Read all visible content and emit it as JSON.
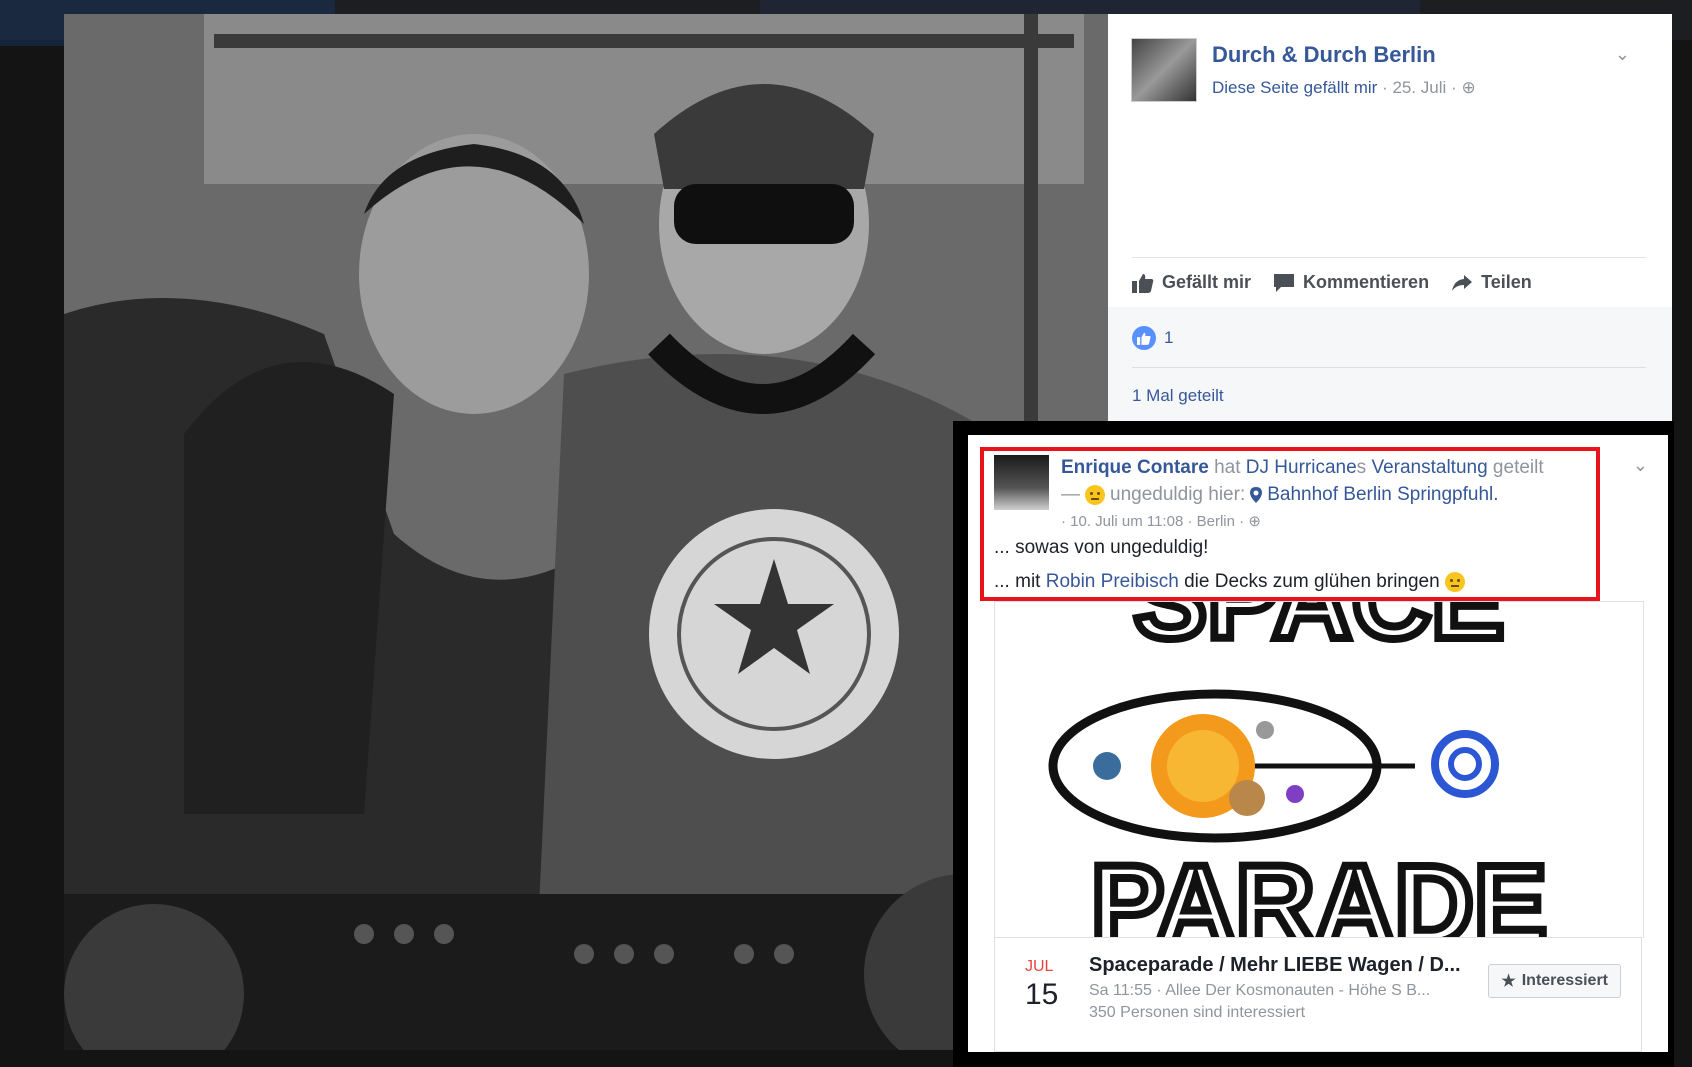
{
  "post": {
    "page_name": "Durch & Durch Berlin",
    "liked_label": "Diese Seite gefällt mir",
    "date": " · 25. Juli · ",
    "actions": {
      "like": "Gefällt mir",
      "comment": "Kommentieren",
      "share": "Teilen"
    },
    "like_count": "1",
    "share_count": "1 Mal geteilt"
  },
  "shared_post": {
    "author": "Enrique Contare",
    "hat": " hat ",
    "target": "DJ Hurricane",
    "s": "s ",
    "event_word": "Veranstaltung",
    "action": " geteilt",
    "feeling": "— ",
    "feeling_text": " ungeduldig hier: ",
    "location": "Bahnhof Berlin Springpfuhl.",
    "timestamp": "· 10. Juli um 11:08 · Berlin ·",
    "text1": "... sowas von ungeduldig!",
    "text2_prefix": "... mit ",
    "text2_mention": "Robin Preibisch",
    "text2_suffix": " die Decks zum glühen bringen "
  },
  "event": {
    "month": "JUL",
    "day": "15",
    "title": "Spaceparade / Mehr LIEBE Wagen / D...",
    "details": "Sa 11:55 · Allee Der Kosmonauten - Höhe S B...",
    "interested_count": "350 Personen sind interessiert",
    "button": "Interessiert",
    "logo_top": "SPACE",
    "logo_bottom": "PARADE"
  },
  "colors": {
    "link": "#365899",
    "highlight_box": "#e8141c",
    "like_blue": "#5890ff"
  }
}
